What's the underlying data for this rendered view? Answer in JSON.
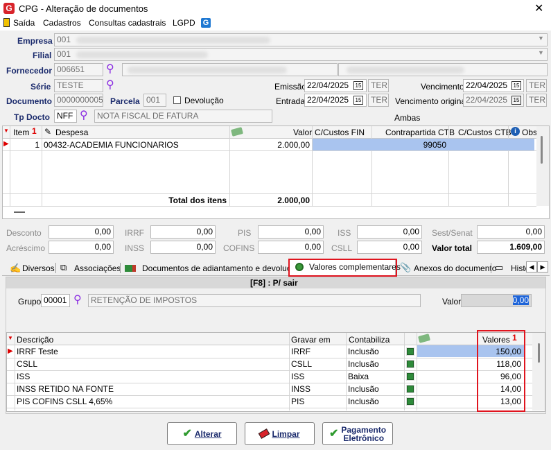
{
  "window": {
    "title": "CPG - Alteração de documentos"
  },
  "menu": [
    {
      "label": "Saída"
    },
    {
      "label": "Cadastros"
    },
    {
      "label": "Consultas cadastrais"
    },
    {
      "label": "LGPD"
    }
  ],
  "form": {
    "empresa_label": "Empresa",
    "empresa_value": "001",
    "filial_label": "Filial",
    "filial_value": "001",
    "fornecedor_label": "Fornecedor",
    "fornecedor_value": "006651",
    "serie_label": "Série",
    "serie_value": "TESTE",
    "documento_label": "Documento",
    "documento_value": "0000000005",
    "parcela_label": "Parcela",
    "parcela_value": "001",
    "devolucao_label": "Devolução",
    "tpdocto_label": "Tp Docto",
    "tpdocto_value": "NFF",
    "tpdocto_desc": "NOTA FISCAL DE FATURA",
    "emissao_label": "Emissão",
    "emissao_value": "22/04/2025",
    "emissao_day": "TER",
    "entrada_label": "Entrada",
    "entrada_value": "22/04/2025",
    "entrada_day": "TER",
    "vencimento_label": "Vencimento",
    "vencimento_value": "22/04/2025",
    "vencimento_day": "TER",
    "vencimento_original_label": "Vencimento original",
    "vencimento_original_value": "22/04/2025",
    "vencimento_original_day": "TER",
    "ambas_label": "Ambas",
    "calendar_label": "15"
  },
  "items_grid": {
    "columns": [
      "Item",
      "Despesa",
      "Valor",
      "C/Custos FIN",
      "Contrapartida CTB",
      "C/Custos CTB",
      "Obs"
    ],
    "sort_indicator": "1",
    "rows": [
      {
        "item": "1",
        "despesa": "00432-ACADEMIA FUNCIONARIOS",
        "valor": "2.000,00",
        "ccfin": "",
        "contrapartida": "99050",
        "ccctb": ""
      }
    ],
    "total_label": "Total dos itens",
    "total_value": "2.000,00"
  },
  "taxes": {
    "desconto_label": "Desconto",
    "desconto": "0,00",
    "irrf_label": "IRRF",
    "irrf": "0,00",
    "pis_label": "PIS",
    "pis": "0,00",
    "iss_label": "ISS",
    "iss": "0,00",
    "sest_label": "Sest/Senat",
    "sest": "0,00",
    "acrescimo_label": "Acréscimo",
    "acrescimo": "0,00",
    "inss_label": "INSS",
    "inss": "0,00",
    "cofins_label": "COFINS",
    "cofins": "0,00",
    "csll_label": "CSLL",
    "csll": "0,00",
    "valor_total_label": "Valor total",
    "valor_total": "1.609,00"
  },
  "tabs": [
    {
      "label": "Diversos"
    },
    {
      "label": "Associações"
    },
    {
      "label": "Documentos de adiantamento e devolução"
    },
    {
      "label": "Valores complementares"
    },
    {
      "label": "Anexos do documento"
    },
    {
      "label": "Histó"
    }
  ],
  "vc": {
    "header": "[F8] : P/ sair",
    "grupo_label": "Grupo",
    "grupo_value": "00001",
    "grupo_desc": "RETENÇÃO DE IMPOSTOS",
    "valor_label": "Valor",
    "valor_value": "0,00",
    "columns": [
      "Descrição",
      "Gravar em",
      "Contabiliza",
      "Valores"
    ],
    "sort_indicator": "1",
    "rows": [
      {
        "descricao": "IRRF Teste",
        "gravar": "IRRF",
        "contabiliza": "Inclusão",
        "valor": "150,00"
      },
      {
        "descricao": "CSLL",
        "gravar": "CSLL",
        "contabiliza": "Inclusão",
        "valor": "118,00"
      },
      {
        "descricao": "ISS",
        "gravar": "ISS",
        "contabiliza": "Baixa",
        "valor": "96,00"
      },
      {
        "descricao": "INSS RETIDO NA FONTE",
        "gravar": "INSS",
        "contabiliza": "Inclusão",
        "valor": "14,00"
      },
      {
        "descricao": "PIS COFINS CSLL 4,65%",
        "gravar": "PIS",
        "contabiliza": "Inclusão",
        "valor": "13,00"
      }
    ]
  },
  "buttons": {
    "alterar": "Alterar",
    "limpar": "Limpar",
    "pagamento_line1": "Pagamento",
    "pagamento_line2": "Eletrônico"
  },
  "colors": {
    "accent_red": "#e0141e",
    "selection_blue": "#a9c4ef",
    "header_blue": "#1a2a6c"
  }
}
